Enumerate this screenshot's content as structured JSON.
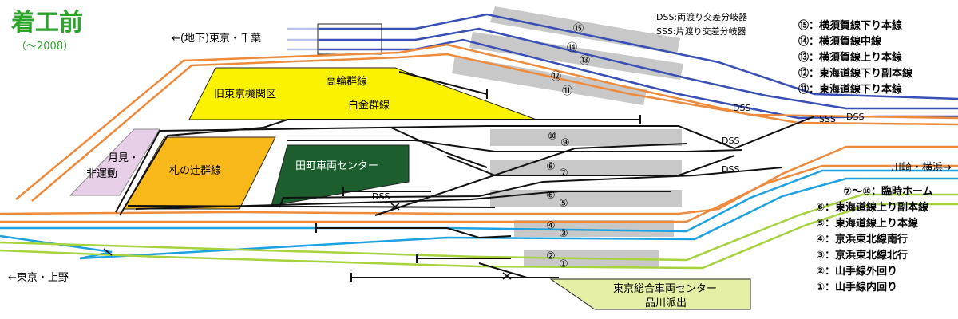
{
  "header": {
    "title": "着工前",
    "subtitle": "（～2008）"
  },
  "colors": {
    "title_green": "#2aa52a",
    "yokosuka": "#3a4fb5",
    "tokaido": "#ee8a3c",
    "keihin": "#1da1e0",
    "yamanote": "#a6d23e",
    "siding_black": "#111111",
    "platform_gray": "#c8c8c8",
    "takanawa_yellow": "#fbf200",
    "fudanotsuji_orange": "#f9b81a",
    "tamachi_green": "#1c5e2e",
    "gekken_pink": "#e8cfe8",
    "soko_lightgreen": "#e5f0a6"
  },
  "directions": {
    "chika": "←(地下)東京・千葉",
    "kawasaki": "川崎・横浜→",
    "ueno": "←東京・上野"
  },
  "switch_legend": {
    "dss": "DSS:両渡り交差分岐器",
    "sss": "SSS:片渡り交差分岐器"
  },
  "areas": {
    "kyu_tokyo": "旧東京機関区",
    "takanawa": "高輪群線",
    "shirogane": "白金群線",
    "tsukimi_1": "月見・",
    "tsukimi_2": "非運動",
    "fudanotsuji": "札の辻群線",
    "tamachi": "田町車両センター",
    "tokyo_sogo_1": "東京総合車両センター",
    "tokyo_sogo_2": "品川派出"
  },
  "switch_marks": {
    "dss": "DSS",
    "sss": "SSS"
  },
  "platform_numbers": {
    "n15": "⑮",
    "n14": "⑭",
    "n13": "⑬",
    "n12": "⑫",
    "n11": "⑪",
    "n10": "⑩",
    "n9": "⑨",
    "n8": "⑧",
    "n7": "⑦",
    "n6": "⑥",
    "n5": "⑤",
    "n4": "④",
    "n3": "③",
    "n2": "②",
    "n1": "①"
  },
  "legend_lines": [
    "⑮：横須賀線下り本線",
    "⑭：横須賀線中線",
    "⑬：横須賀線上り本線",
    "⑫：東海道線下り副本線",
    "⑪：東海道線下り本線",
    "⑦～⑩：臨時ホーム",
    "⑥：東海道線上り副本線",
    "⑤：東海道線上り本線",
    "④：京浜東北線南行",
    "③：京浜東北線北行",
    "②：山手線外回り",
    "①：山手線内回り"
  ]
}
